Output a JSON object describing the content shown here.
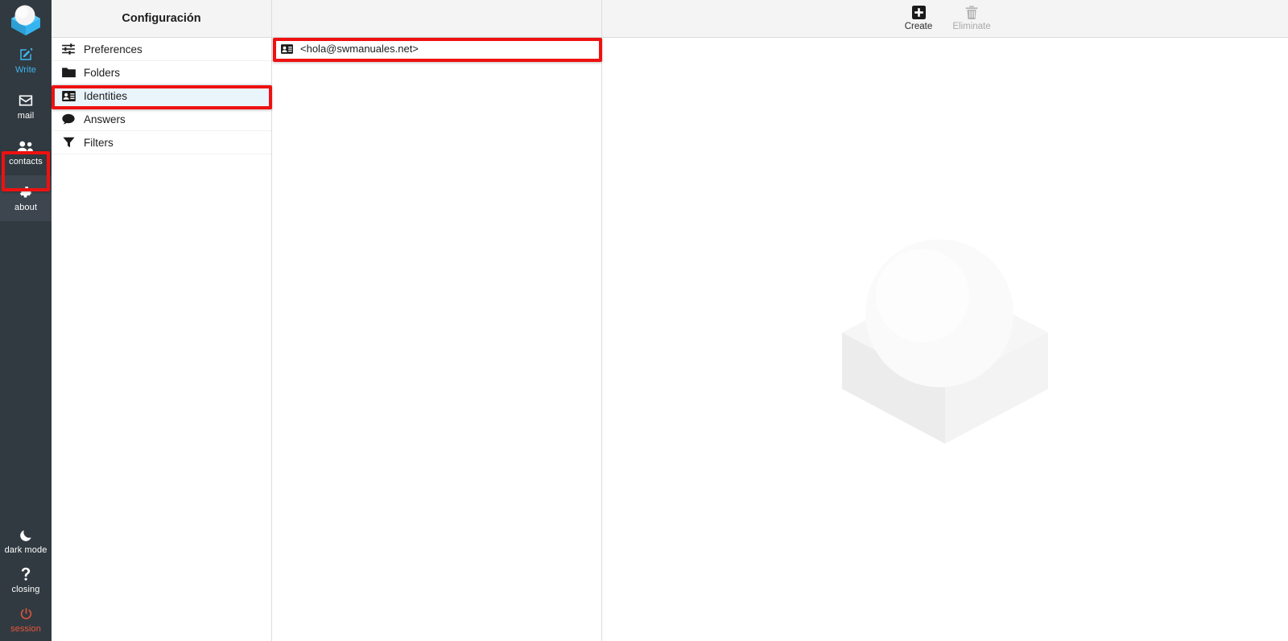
{
  "taskbar": {
    "logo": {
      "name": "roundcube-logo",
      "colors": {
        "box": "#35b5f0",
        "sphere": "#f2f2f2"
      }
    },
    "top_items": [
      {
        "id": "write",
        "label": "Write",
        "icon": "compose-icon",
        "accent": true,
        "selected": false
      },
      {
        "id": "mail",
        "label": "mail",
        "icon": "envelope-icon",
        "accent": false,
        "selected": false
      },
      {
        "id": "contacts",
        "label": "contacts",
        "icon": "people-icon",
        "accent": false,
        "selected": false
      },
      {
        "id": "about",
        "label": "about",
        "icon": "gear-icon",
        "accent": false,
        "selected": true
      }
    ],
    "bottom_items": [
      {
        "id": "dark-mode",
        "label": "dark mode",
        "icon": "moon-icon",
        "danger": false
      },
      {
        "id": "closing",
        "label": "closing",
        "icon": "question-icon",
        "danger": false
      },
      {
        "id": "session",
        "label": "session",
        "icon": "power-icon",
        "danger": true
      }
    ]
  },
  "settings": {
    "header_title": "Configuración",
    "items": [
      {
        "id": "preferences",
        "label": "Preferences",
        "icon": "sliders-icon",
        "active": false
      },
      {
        "id": "folders",
        "label": "Folders",
        "icon": "folder-icon",
        "active": false
      },
      {
        "id": "identities",
        "label": "Identities",
        "icon": "contact-card-icon",
        "active": true
      },
      {
        "id": "answers",
        "label": "Answers",
        "icon": "speech-bubble-icon",
        "active": false
      },
      {
        "id": "filters",
        "label": "Filters",
        "icon": "funnel-icon",
        "active": false
      }
    ]
  },
  "identities": {
    "rows": [
      {
        "id": "identity-1",
        "label": "<hola@swmanuales.net>",
        "icon": "contact-card-icon"
      }
    ]
  },
  "content": {
    "toolbar": {
      "create_label": "Create",
      "create_icon": "plus-square-icon",
      "eliminate_label": "Eliminate",
      "eliminate_icon": "trash-icon",
      "eliminate_disabled": true
    },
    "watermark_icon": "roundcube-watermark-logo"
  },
  "annotations": {
    "accent_color": "#ee1111",
    "boxes": [
      {
        "id": "annot-about",
        "target": "taskbar-item-about"
      },
      {
        "id": "annot-ident",
        "target": "settings-item-identities"
      },
      {
        "id": "annot-identrow",
        "target": "identity-row-1"
      }
    ]
  }
}
